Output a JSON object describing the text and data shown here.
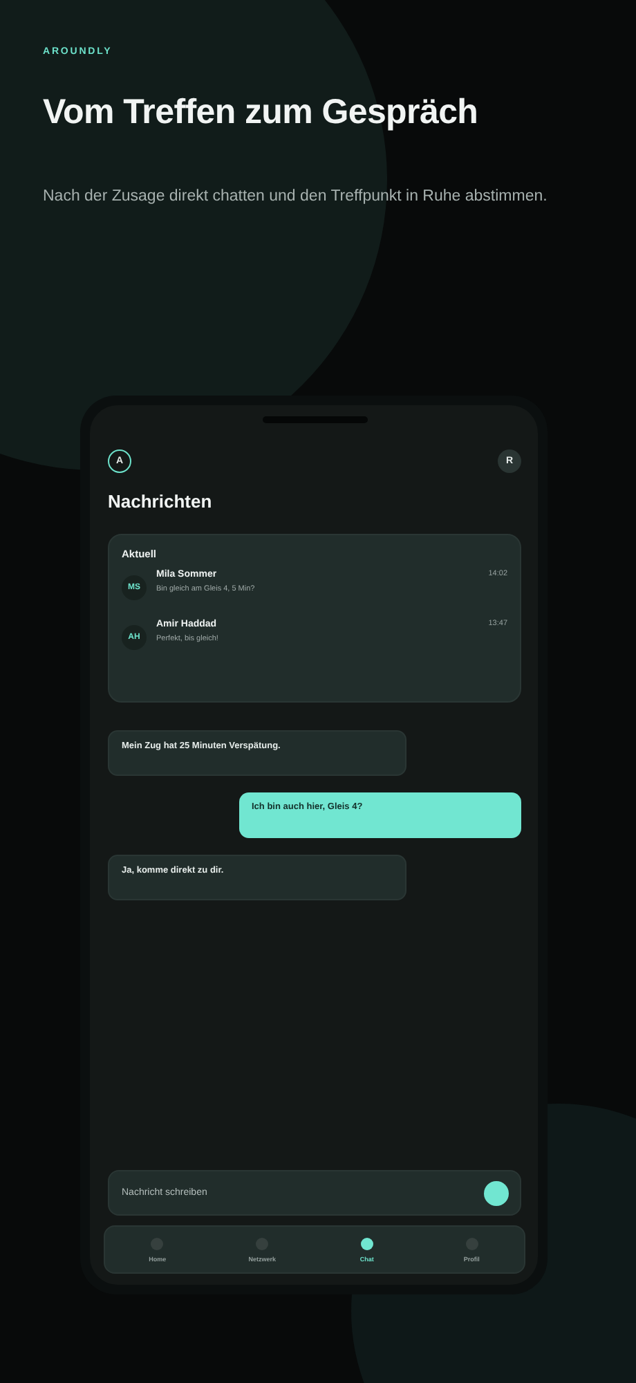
{
  "brand": "AROUNDLY",
  "headline": "Vom Treffen zum Gespräch",
  "subline": "Nach der Zusage direkt chatten und den Treffpunkt in Ruhe abstimmen.",
  "phone": {
    "left_avatar": "A",
    "right_avatar": "R",
    "title": "Nachrichten",
    "recent": {
      "label": "Aktuell",
      "conversations": [
        {
          "initials": "MS",
          "name": "Mila Sommer",
          "time": "14:02",
          "preview": "Bin gleich am Gleis 4, 5 Min?"
        },
        {
          "initials": "AH",
          "name": "Amir Haddad",
          "time": "13:47",
          "preview": "Perfekt, bis gleich!"
        }
      ]
    },
    "messages": [
      {
        "kind": "incoming",
        "text": "Mein Zug hat 25 Minuten Verspätung."
      },
      {
        "kind": "outgoing",
        "text": "Ich bin auch hier, Gleis 4?"
      },
      {
        "kind": "incoming",
        "text": "Ja, komme direkt zu dir."
      }
    ],
    "composer": {
      "placeholder": "Nachricht schreiben"
    },
    "nav": [
      {
        "label": "Home",
        "selected": false
      },
      {
        "label": "Netzwerk",
        "selected": false
      },
      {
        "label": "Chat",
        "selected": true
      },
      {
        "label": "Profil",
        "selected": false
      }
    ]
  }
}
